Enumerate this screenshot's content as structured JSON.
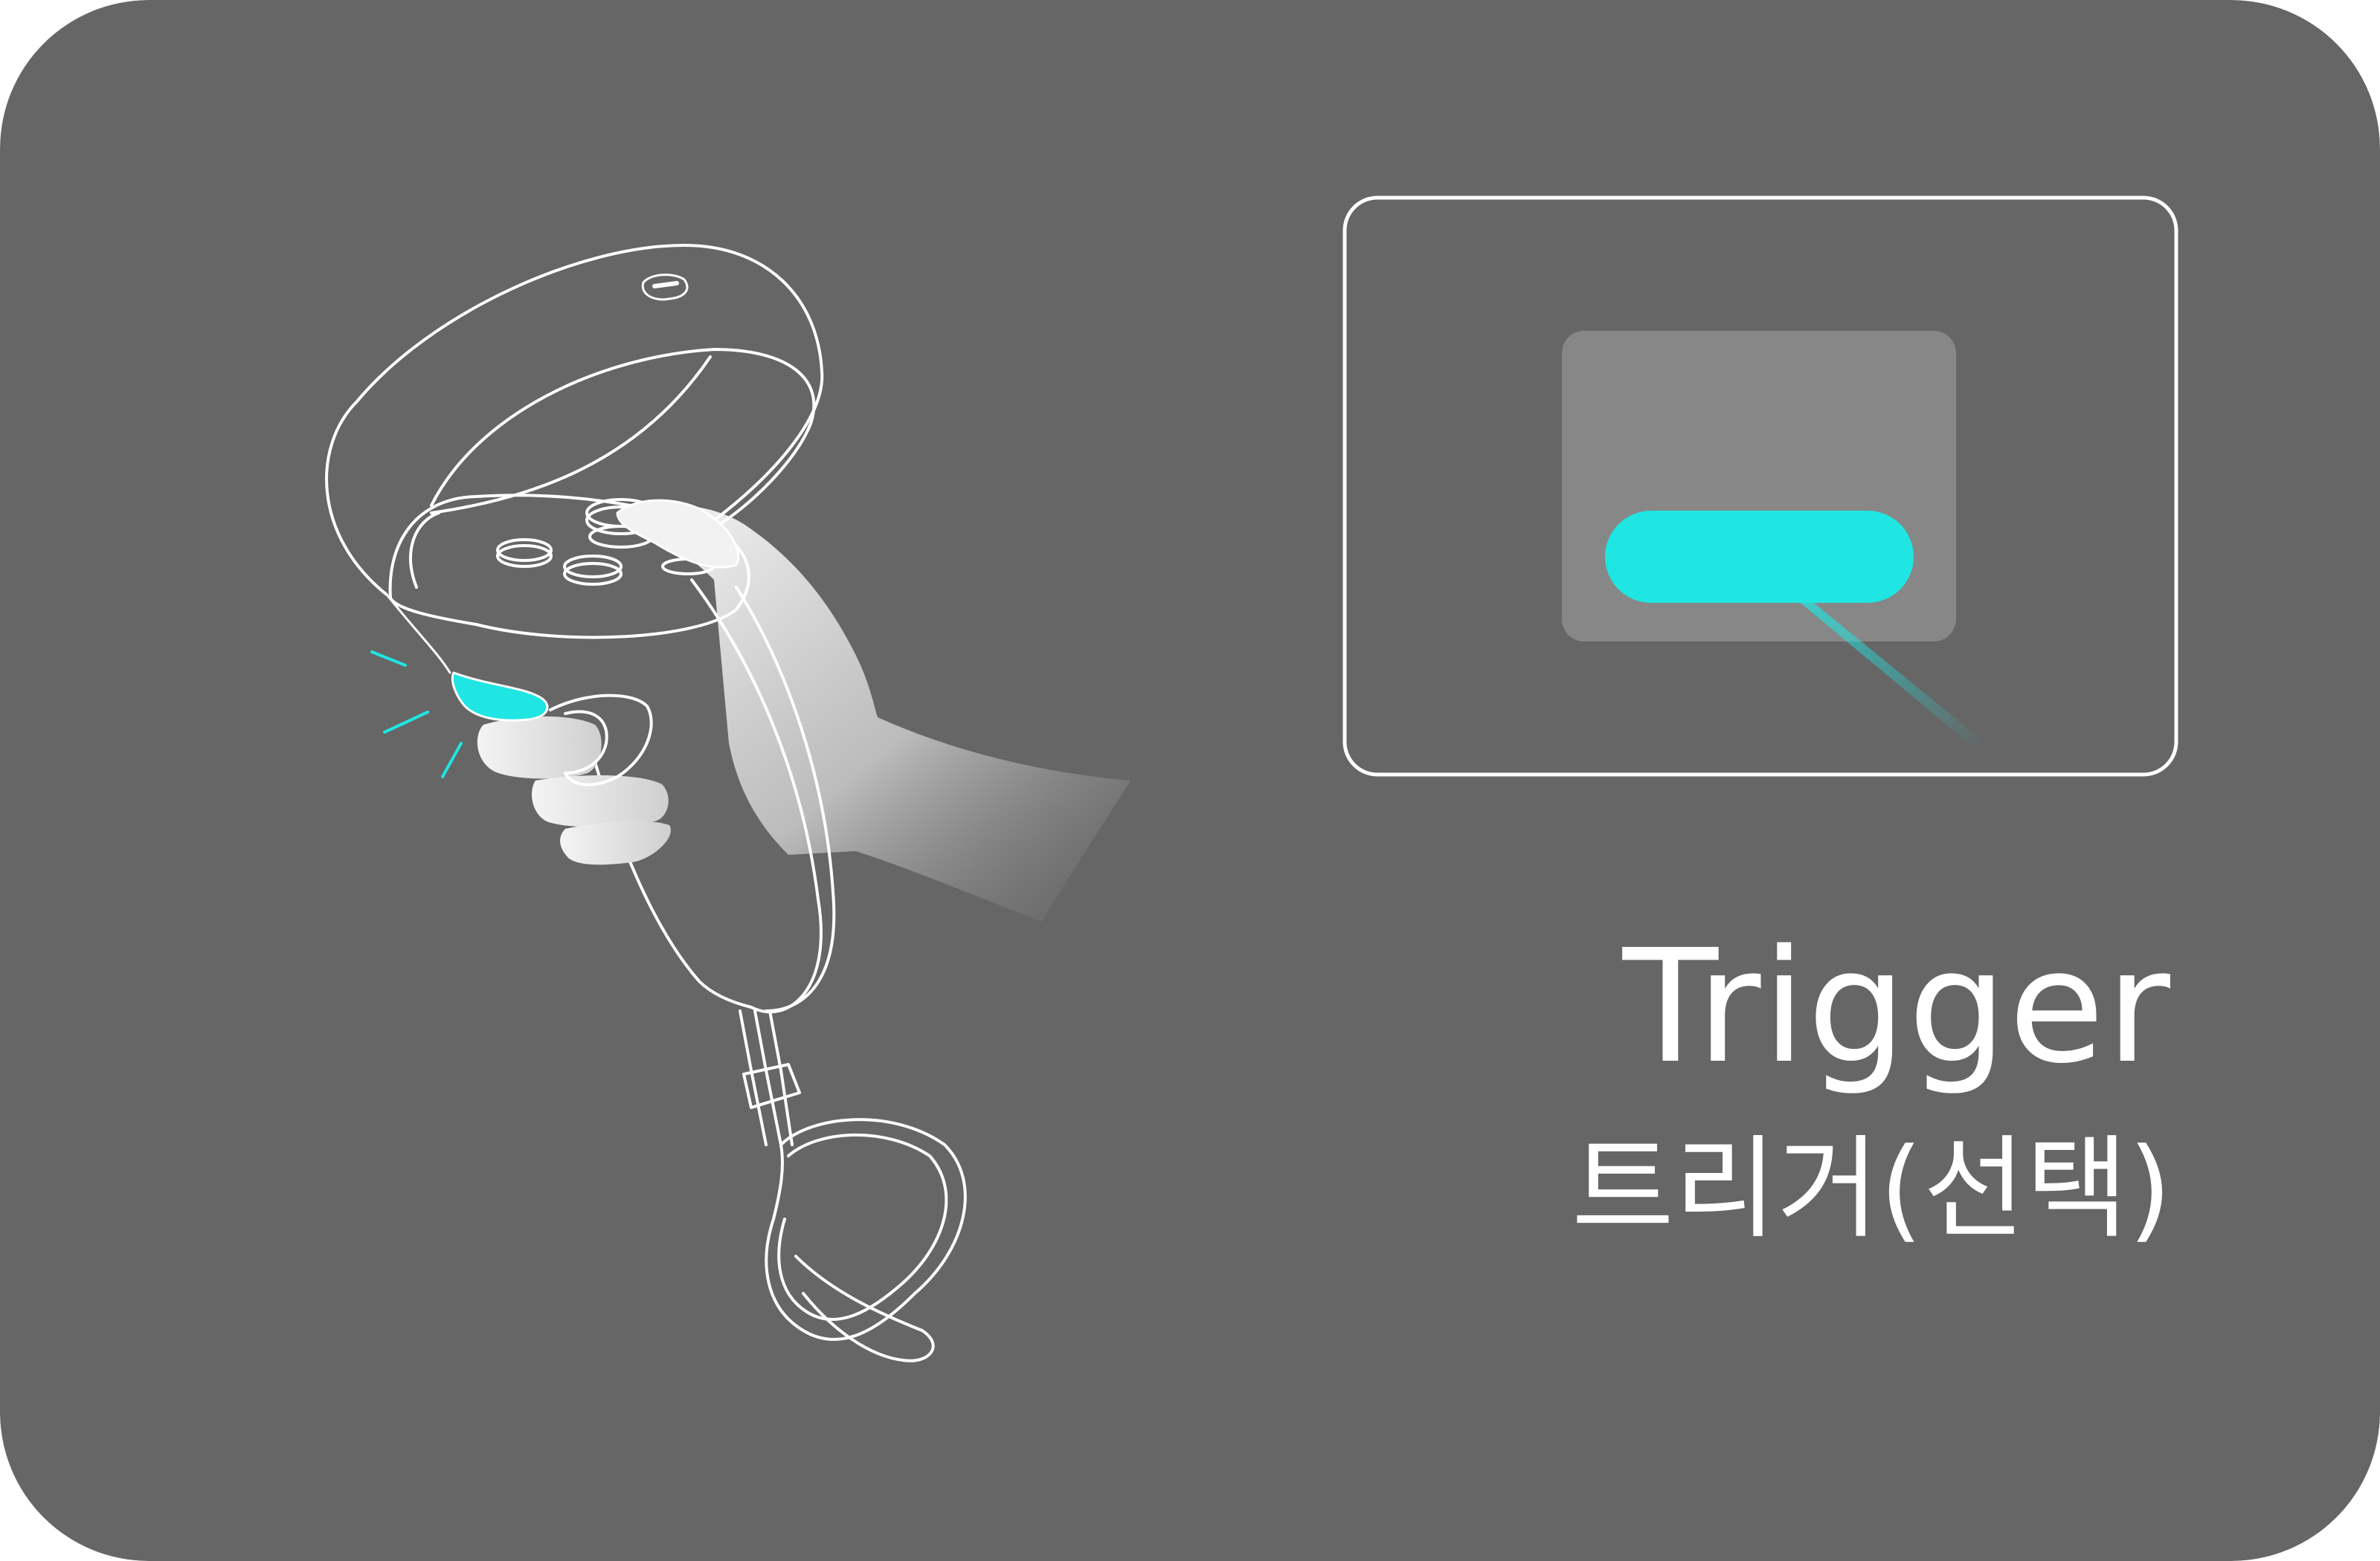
{
  "heading": {
    "english": "Trigger",
    "korean": "트리거(선택)"
  },
  "colors": {
    "card_background": "#666666",
    "line_art": "#ffffff",
    "accent": "#1fe6e2",
    "button_panel": "#878787"
  },
  "icons": {
    "illustration": "hand-holding-vr-controller",
    "highlighted_part": "trigger-button",
    "screen": "selection-screen"
  }
}
